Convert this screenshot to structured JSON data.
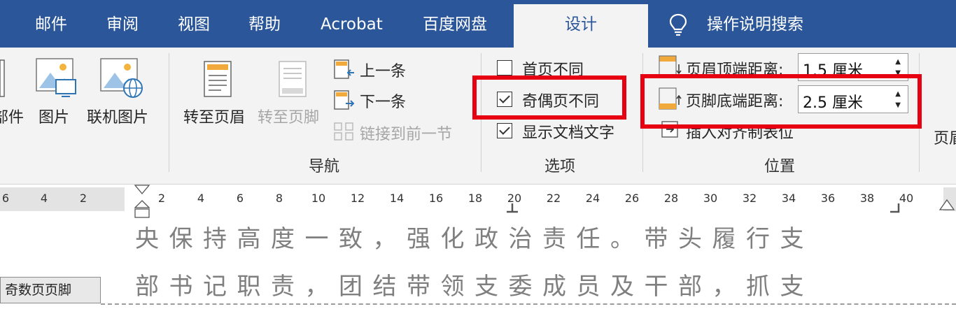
{
  "tabs": [
    {
      "label": "邮件"
    },
    {
      "label": "审阅"
    },
    {
      "label": "视图"
    },
    {
      "label": "帮助"
    },
    {
      "label": "Acrobat"
    },
    {
      "label": "百度网盘"
    },
    {
      "label": "设计",
      "active": true
    },
    {
      "label": "操作说明搜索"
    }
  ],
  "ribbon": {
    "insert": {
      "parts_label": "部件",
      "picture_label": "图片",
      "online_picture_label": "联机图片"
    },
    "navigation": {
      "goto_header": "转至页眉",
      "goto_footer": "转至页脚",
      "previous": "上一条",
      "next": "下一条",
      "link_previous": "链接到前一节",
      "group_label": "导航"
    },
    "options": {
      "different_first_page": {
        "label": "首页不同",
        "checked": false
      },
      "different_odd_even": {
        "label": "奇偶页不同",
        "checked": true
      },
      "show_document_text": {
        "label": "显示文档文字",
        "checked": true
      },
      "group_label": "选项"
    },
    "position": {
      "header_from_top": {
        "label": "页眉顶端距离:",
        "value": "1.5 厘米"
      },
      "footer_from_bottom": {
        "label": "页脚底端距离:",
        "value": "2.5 厘米"
      },
      "insert_alignment_tab": "插入对齐制表位",
      "group_label": "位置"
    },
    "close_partial": "页眉"
  },
  "ruler": {
    "left_ticks": [
      "6",
      "4",
      "2"
    ],
    "right_ticks": [
      "2",
      "4",
      "6",
      "8",
      "10",
      "12",
      "14",
      "16",
      "18",
      "20",
      "22",
      "24",
      "26",
      "28",
      "30",
      "32",
      "34",
      "36",
      "38",
      "40"
    ]
  },
  "document": {
    "lines": [
      "央保持高度一致，强化政治责任。带头履行支",
      "部书记职责，团结带领支委成员及干部，抓支"
    ],
    "footer_tag": "奇数页页脚"
  },
  "colors": {
    "title_bar": "#2b579a",
    "ribbon_bg": "#f3f3f3",
    "highlight_box": "#e60012",
    "doc_text": "#7f7f7f"
  }
}
